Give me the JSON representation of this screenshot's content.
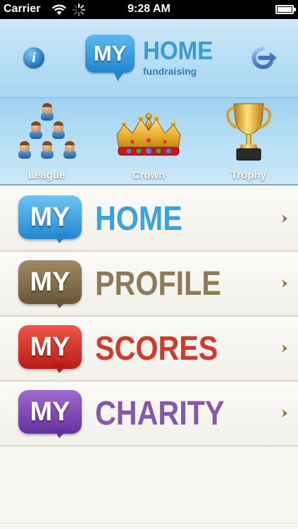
{
  "status_bar": {
    "carrier": "Carrier",
    "time": "9:28 AM"
  },
  "header": {
    "logo_my": "MY",
    "logo_home": "HOME",
    "logo_sub": "fundraising",
    "info_label": "i"
  },
  "awards": [
    {
      "label": "League",
      "icon": "league-people-icon"
    },
    {
      "label": "Crown",
      "icon": "crown-icon"
    },
    {
      "label": "Trophy",
      "icon": "trophy-icon"
    }
  ],
  "menu": [
    {
      "my": "MY",
      "label": "HOME",
      "color": "#3aa2dd",
      "bubble": "#2b95d8"
    },
    {
      "my": "MY",
      "label": "PROFILE",
      "color": "#8c7a58",
      "bubble": "#7e6a4c"
    },
    {
      "my": "MY",
      "label": "SCORES",
      "color": "#d23b2c",
      "bubble": "#d12c22"
    },
    {
      "my": "MY",
      "label": "CHARITY",
      "color": "#8658ad",
      "bubble": "#7d47b1"
    }
  ]
}
